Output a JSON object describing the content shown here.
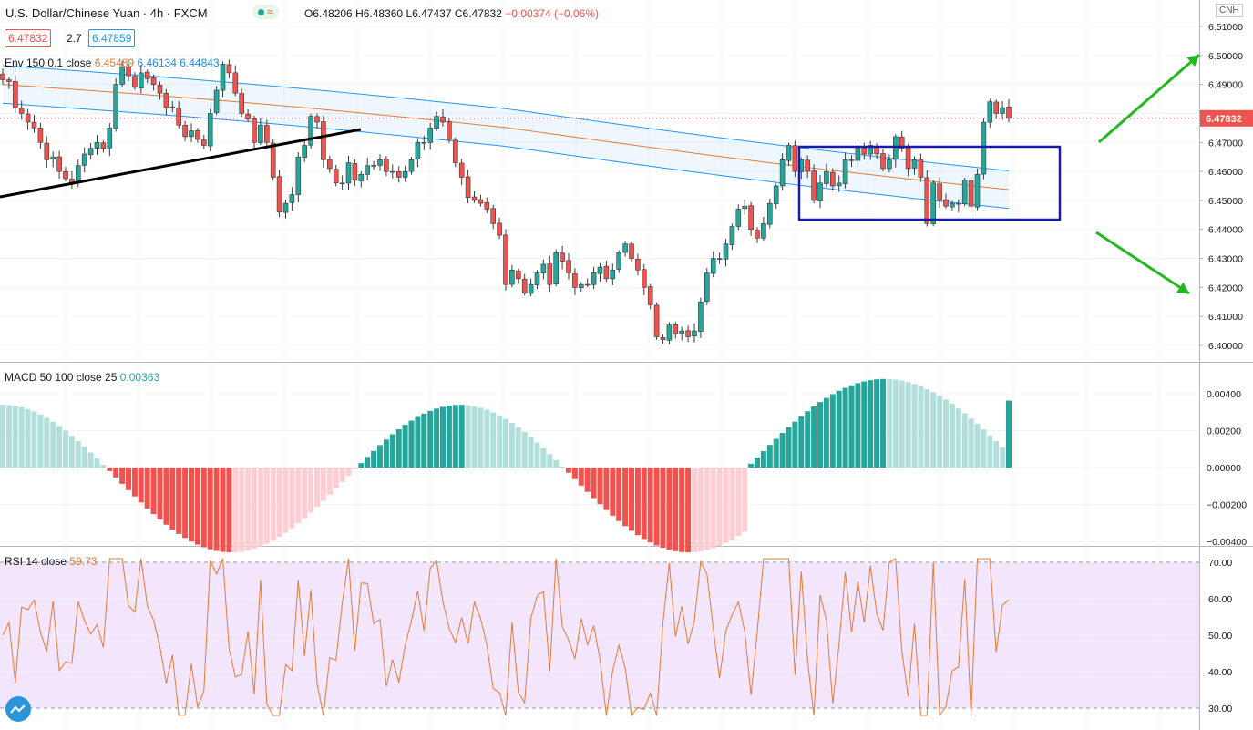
{
  "header": {
    "symbol": "U.S. Dollar/Chinese Yuan · 4h · FXCM",
    "open": "O6.48206",
    "high": "H6.48360",
    "low": "L6.47437",
    "close": "C6.47832",
    "change": "−0.00374 (−0.06%)",
    "bid": "6.47832",
    "spread": "2.7",
    "ask": "6.47859"
  },
  "envelope_legend": {
    "label": "Env 150 0.1 close",
    "basis": "6.45489",
    "upper": "6.46134",
    "lower": "6.44843"
  },
  "macd_legend": {
    "label": "MACD 50 100 close 25",
    "value": "0.00363"
  },
  "rsi_legend": {
    "label": "RSI 14 close",
    "value": "59.73"
  },
  "currency_tag": "CNH",
  "colors": {
    "up": "#26a69a",
    "down": "#ef5350",
    "env_basis": "#e07b39",
    "env_band": "#2196f3",
    "rsi_line": "#e07b39",
    "rsi_fill": "#f3e5fb",
    "box": "#1a1aa8",
    "arrow": "#22b822"
  },
  "chart_data": [
    {
      "type": "candlestick",
      "title": "U.S. Dollar/Chinese Yuan · 4h · FXCM",
      "ylim": [
        6.396,
        6.516
      ],
      "y_ticks": [
        "6.51000",
        "6.50000",
        "6.49000",
        "6.48000",
        "6.47000",
        "6.46000",
        "6.45000",
        "6.44000",
        "6.43000",
        "6.42000",
        "6.41000",
        "6.40000"
      ],
      "y_tick_values": [
        6.51,
        6.5,
        6.49,
        6.48,
        6.47,
        6.46,
        6.45,
        6.44,
        6.43,
        6.42,
        6.41,
        6.4
      ],
      "last_price_label": "6.47832",
      "last_price": 6.47832,
      "close": [
        6.4916,
        6.491,
        6.482,
        6.48,
        6.477,
        6.475,
        6.47,
        6.464,
        6.465,
        6.46,
        6.4575,
        6.456,
        6.462,
        6.466,
        6.468,
        6.47,
        6.468,
        6.475,
        6.49,
        6.496,
        6.493,
        6.489,
        6.494,
        6.492,
        6.49,
        6.487,
        6.482,
        6.482,
        6.476,
        6.472,
        6.474,
        6.471,
        6.469,
        6.48,
        6.488,
        6.497,
        6.494,
        6.487,
        6.48,
        6.478,
        6.47,
        6.476,
        6.47,
        6.458,
        6.446,
        6.449,
        6.452,
        6.465,
        6.469,
        6.479,
        6.477,
        6.464,
        6.461,
        6.456,
        6.456,
        6.463,
        6.457,
        6.459,
        6.462,
        6.462,
        6.464,
        6.46,
        6.46,
        6.458,
        6.46,
        6.464,
        6.47,
        6.47,
        6.475,
        6.479,
        6.477,
        6.471,
        6.463,
        6.458,
        6.451,
        6.45,
        6.449,
        6.447,
        6.442,
        6.438,
        6.421,
        6.426,
        6.423,
        6.418,
        6.421,
        6.425,
        6.428,
        6.421,
        6.432,
        6.429,
        6.425,
        6.42,
        6.421,
        6.421,
        6.425,
        6.427,
        6.423,
        6.426,
        6.432,
        6.435,
        6.43,
        6.426,
        6.42,
        6.414,
        6.403,
        6.402,
        6.407,
        6.404,
        6.405,
        6.403,
        6.405,
        6.415,
        6.425,
        6.43,
        6.43,
        6.435,
        6.441,
        6.447,
        6.448,
        6.44,
        6.437,
        6.442,
        6.449,
        6.455,
        6.464,
        6.469,
        6.46,
        6.464,
        6.46,
        6.45,
        6.456,
        6.46,
        6.455,
        6.456,
        6.464,
        6.464,
        6.468,
        6.466,
        6.469,
        6.466,
        6.461,
        6.464,
        6.472,
        6.468,
        6.461,
        6.464,
        6.458,
        6.442,
        6.456,
        6.45,
        6.448,
        6.449,
        6.449,
        6.457,
        6.448,
        6.459,
        6.477,
        6.484,
        6.48,
        6.482,
        6.4783
      ],
      "xlabel": "",
      "ylabel": ""
    },
    {
      "type": "bar",
      "title": "MACD 50 100 close 25",
      "ylim": [
        -0.0042,
        0.0042
      ],
      "y_ticks": [
        "0.00400",
        "0.00200",
        "0.00000",
        "−0.00200",
        "−0.00400"
      ],
      "y_tick_values": [
        0.004,
        0.002,
        0.0,
        -0.002,
        -0.004
      ],
      "last_value": 0.00363
    },
    {
      "type": "line",
      "title": "RSI 14 close",
      "ylim": [
        26,
        74
      ],
      "band": [
        30,
        70
      ],
      "y_ticks": [
        "70.00",
        "60.00",
        "50.00",
        "40.00",
        "30.00"
      ],
      "y_tick_values": [
        70,
        60,
        50,
        40,
        30
      ],
      "last_value": 59.73
    }
  ]
}
